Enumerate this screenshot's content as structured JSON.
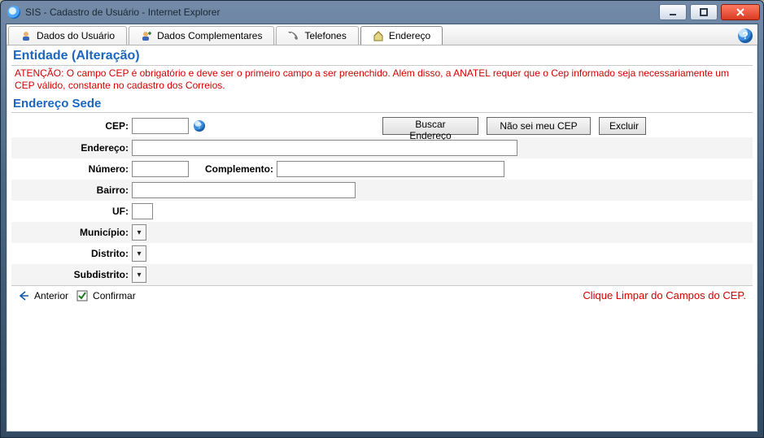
{
  "window": {
    "title": "SIS - Cadastro de Usuário - Internet Explorer"
  },
  "tabs": {
    "user": "Dados do Usuário",
    "complement": "Dados Complementares",
    "phones": "Telefones",
    "address": "Endereço"
  },
  "page": {
    "heading": "Entidade (Alteração)",
    "warning": "ATENÇÃO: O campo CEP é obrigatório e deve ser o primeiro campo a ser preenchido. Além disso, a ANATEL requer que o Cep informado seja necessariamente um CEP válido, constante no cadastro dos Correios.",
    "subheading": "Endereço Sede"
  },
  "labels": {
    "cep": "CEP:",
    "endereco": "Endereço:",
    "numero": "Número:",
    "complemento": "Complemento:",
    "bairro": "Bairro:",
    "uf": "UF:",
    "municipio": "Município:",
    "distrito": "Distrito:",
    "subdistrito": "Subdistrito:"
  },
  "buttons": {
    "buscar": "Buscar Endereço",
    "naosei": "Não sei meu CEP",
    "excluir": "Excluir"
  },
  "footer": {
    "anterior": "Anterior",
    "confirmar": "Confirmar",
    "hint": "Clique Limpar do Campos do CEP."
  },
  "help_glyph": "?"
}
